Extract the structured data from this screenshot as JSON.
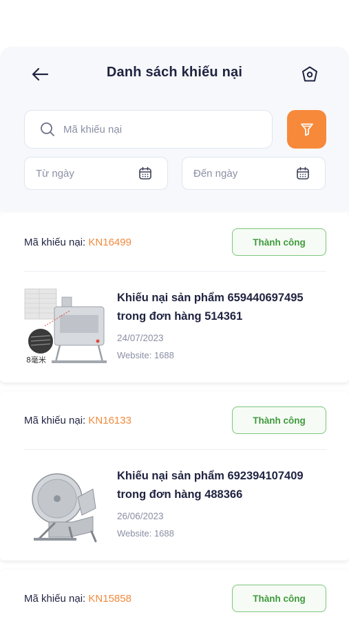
{
  "header": {
    "title": "Danh sách khiếu nại"
  },
  "search": {
    "placeholder": "Mã khiếu nại",
    "value": ""
  },
  "filters": {
    "from_date_label": "Từ ngày",
    "to_date_label": "Đến ngày"
  },
  "colors": {
    "accent": "#f7893b",
    "code_text": "#f08a3c",
    "success": "#3f9a3d"
  },
  "icons": {
    "back": "arrow-left-icon",
    "home": "home-icon",
    "search": "search-icon",
    "filter": "filter-icon",
    "calendar": "calendar-icon"
  },
  "complaints": [
    {
      "code_label": "Mã khiếu nại:",
      "code": "KN16499",
      "status": "Thành công",
      "title_line1": "Khiếu nại sản phẩm 659440697495",
      "title_line2": "trong đơn hàng 514361",
      "date": "24/07/2023",
      "website": "Website: 1688",
      "image_caption": "8毫米"
    },
    {
      "code_label": "Mã khiếu nại:",
      "code": "KN16133",
      "status": "Thành công",
      "title_line1": "Khiếu nại sản phẩm 692394107409",
      "title_line2": "trong đơn hàng 488366",
      "date": "26/06/2023",
      "website": "Website: 1688"
    },
    {
      "code_label": "Mã khiếu nại:",
      "code": "KN15858",
      "status": "Thành công"
    }
  ]
}
